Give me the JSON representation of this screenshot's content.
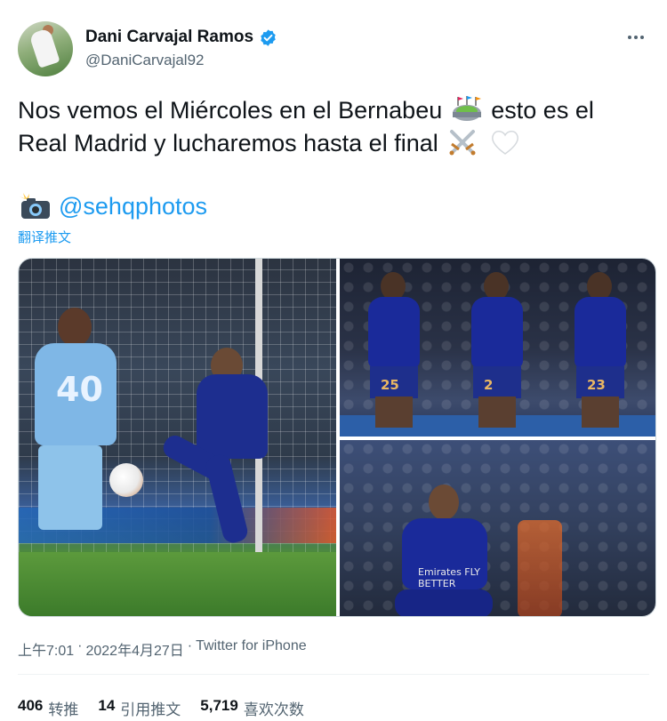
{
  "author": {
    "display_name": "Dani Carvajal Ramos",
    "handle": "@DaniCarvajal92",
    "verified": true,
    "avatar_icon": "profile-photo"
  },
  "tweet": {
    "text_part1": "Nos vemos el Miércoles en el Bernabeu",
    "text_part2": "esto es el Real Madrid y lucharemos hasta el final",
    "emoji_stadium": "stadium-emoji",
    "emoji_swords": "crossed-swords-emoji",
    "emoji_heart": "white-heart-emoji",
    "credit_icon": "camera-flash-emoji",
    "credit_mention": "@sehqphotos",
    "translate_label": "翻译推文"
  },
  "media": {
    "photos": [
      {
        "label": "photo-1",
        "city_number": "40"
      },
      {
        "label": "photo-2",
        "numbers": [
          "25",
          "2",
          "23"
        ]
      },
      {
        "label": "photo-3",
        "sponsor": "Emirates FLY BETTER"
      }
    ]
  },
  "meta": {
    "time": "上午7:01",
    "separator": "·",
    "date": "2022年4月27日",
    "source": "Twitter for iPhone"
  },
  "stats": {
    "retweets_value": "406",
    "retweets_label": "转推",
    "quotes_value": "14",
    "quotes_label": "引用推文",
    "likes_value": "5,719",
    "likes_label": "喜欢次数"
  },
  "colors": {
    "accent": "#1d9bf0",
    "text_primary": "#0f1419",
    "text_secondary": "#536471",
    "verified_badge": "#1d9bf0"
  }
}
